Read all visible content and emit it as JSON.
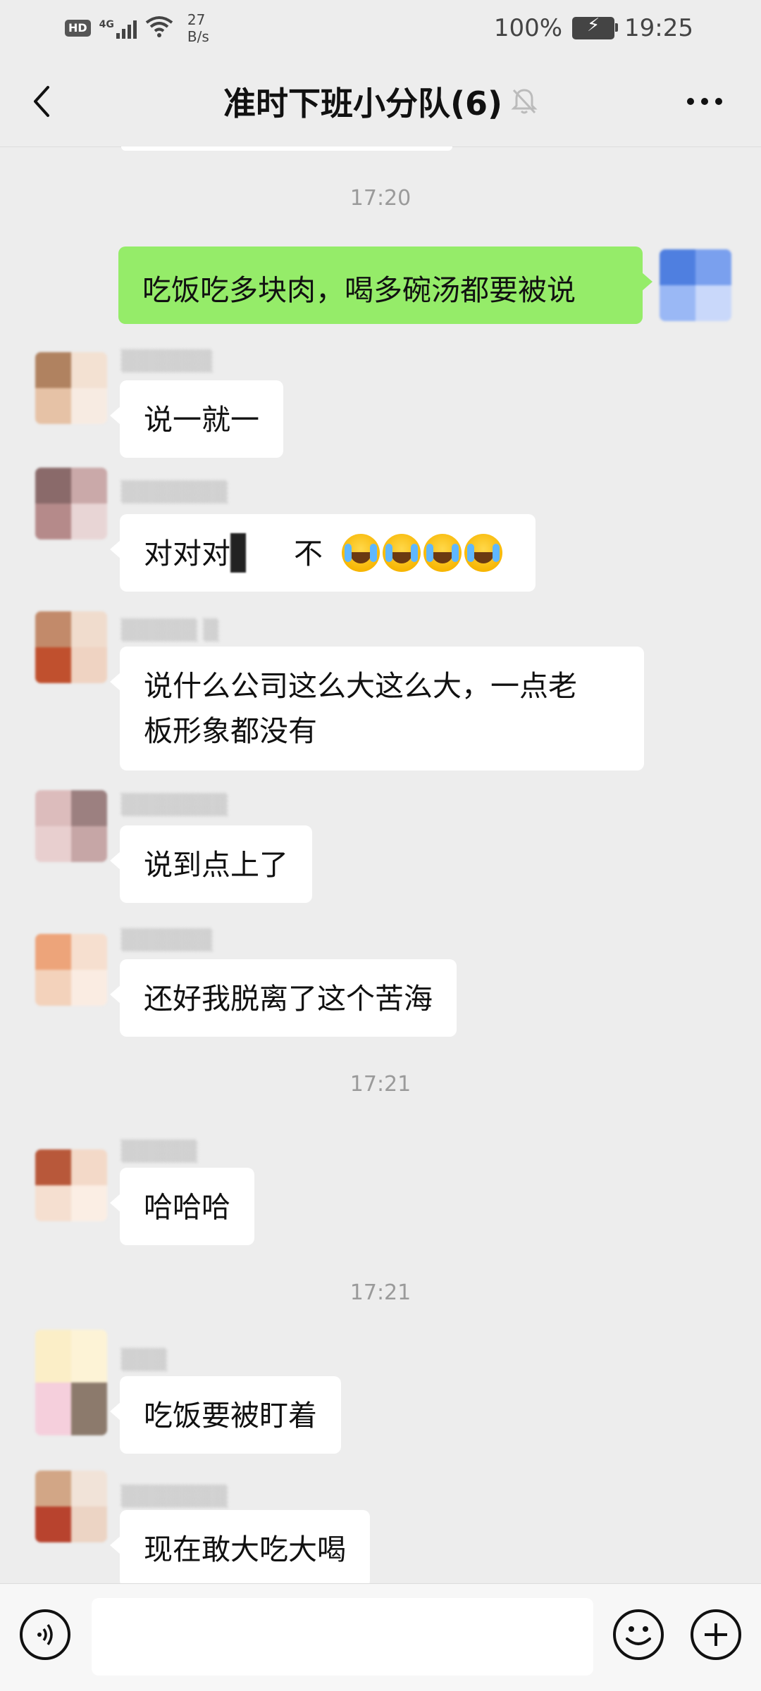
{
  "status_bar": {
    "hd_label": "HD",
    "network": "4G",
    "speed_value": "27",
    "speed_unit": "B/s",
    "battery_percent": "100%",
    "time": "19:25"
  },
  "nav": {
    "title": "准时下班小分队(6)",
    "back_icon": "chevron-left-icon",
    "mute_icon": "bell-muted-icon",
    "more_icon": "more-dots-icon"
  },
  "colors": {
    "outgoing_bubble": "#95ec69",
    "incoming_bubble": "#ffffff",
    "background": "#ededed"
  },
  "chat": {
    "time_1": "17:20",
    "time_2": "17:21",
    "time_3": "17:21",
    "messages": [
      {
        "direction": "outgoing",
        "text": "吃饭吃多块肉，喝多碗汤都要被说"
      },
      {
        "direction": "incoming",
        "text": "说一就一"
      },
      {
        "direction": "incoming",
        "text_prefix": "对对对",
        "text_suffix": "不"
      },
      {
        "direction": "incoming",
        "line1": "说什么公司这么大这么大，一点老",
        "line2": "板形象都没有"
      },
      {
        "direction": "incoming",
        "text": "说到点上了"
      },
      {
        "direction": "incoming",
        "text": "还好我脱离了这个苦海"
      },
      {
        "direction": "incoming",
        "text": "哈哈哈"
      },
      {
        "direction": "incoming",
        "text": "吃饭要被盯着"
      },
      {
        "direction": "incoming",
        "text": "现在敢大吃大喝"
      }
    ]
  },
  "input_bar": {
    "voice_icon": "voice-icon",
    "input_value": "",
    "emoji_icon": "smiley-icon",
    "plus_icon": "plus-icon"
  }
}
